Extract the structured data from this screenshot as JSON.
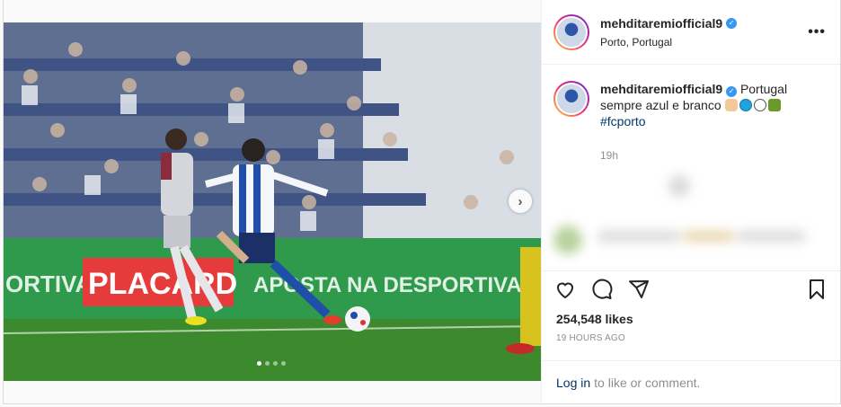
{
  "post": {
    "username": "mehditaremiofficial9",
    "location": "Porto, Portugal",
    "more_label": "•••",
    "verified_icon": "verified-badge-icon",
    "caption": {
      "username": "mehditaremiofficial9",
      "text_line1": "Portugal",
      "text_line2": "sempre azul e branco",
      "emojis": [
        "flexed-biceps",
        "blue-circle",
        "white-circle",
        "dragon"
      ],
      "hashtag": "#fcporto"
    },
    "caption_time": "19h",
    "likes": "254,548 likes",
    "posted_ago": "19 HOURS AGO",
    "login_prompt": {
      "link": "Log in",
      "rest": "to like or comment."
    },
    "carousel": {
      "next_icon": "chevron-right-icon",
      "slide_count": 4,
      "active_index": 0
    },
    "photo_banner": {
      "left": "ORTIVA",
      "brand": "PLACARD",
      "slogan": "APOSTA NA DESPORTIVA"
    }
  },
  "colors": {
    "link": "#00376b",
    "muted": "#8e8e8e",
    "verified": "#3897f0",
    "banner_green": "#2f9a4b",
    "pitch": "#3d8a2e"
  }
}
